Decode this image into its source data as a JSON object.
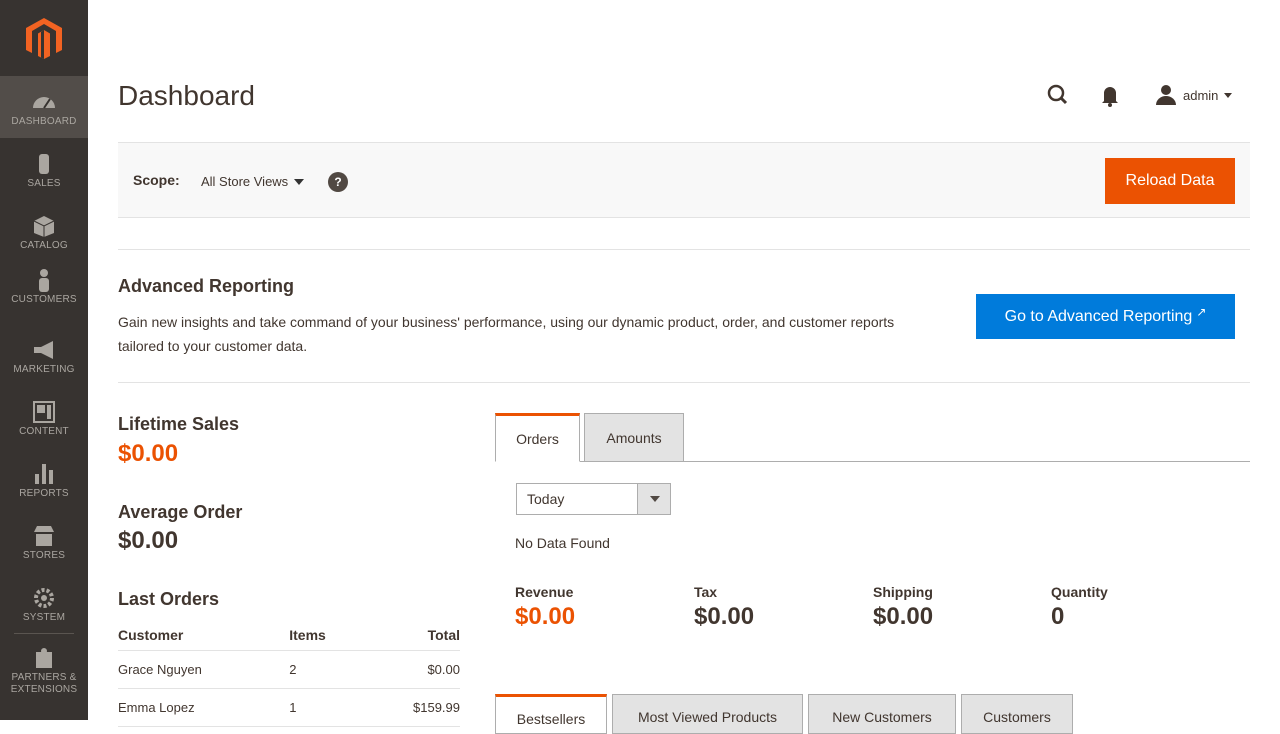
{
  "header": {
    "title": "Dashboard",
    "user": "admin"
  },
  "sidebar": {
    "items": [
      {
        "label": "Dashboard",
        "icon": "dashboard-icon"
      },
      {
        "label": "Sales",
        "icon": "dollar-icon"
      },
      {
        "label": "Catalog",
        "icon": "box-icon"
      },
      {
        "label": "Customers",
        "icon": "person-icon"
      },
      {
        "label": "Marketing",
        "icon": "megaphone-icon"
      },
      {
        "label": "Content",
        "icon": "layout-icon"
      },
      {
        "label": "Reports",
        "icon": "bar-chart-icon"
      },
      {
        "label": "Stores",
        "icon": "store-icon"
      },
      {
        "label": "System",
        "icon": "gear-icon"
      },
      {
        "label": "Partners & Extensions",
        "icon": "puzzle-icon"
      }
    ]
  },
  "scope": {
    "label": "Scope:",
    "value": "All Store Views",
    "help": "?",
    "reload_label": "Reload Data"
  },
  "advanced": {
    "title": "Advanced Reporting",
    "description": "Gain new insights and take command of your business' performance, using our dynamic product, order, and customer reports tailored to your customer data.",
    "button": "Go to Advanced Reporting"
  },
  "stats": {
    "lifetime_label": "Lifetime Sales",
    "lifetime_value": "$0.00",
    "average_label": "Average Order",
    "average_value": "$0.00",
    "last_orders_label": "Last Orders"
  },
  "last_orders": {
    "headers": [
      "Customer",
      "Items",
      "Total"
    ],
    "rows": [
      {
        "customer": "Grace Nguyen",
        "items": "2",
        "total": "$0.00"
      },
      {
        "customer": "Emma Lopez",
        "items": "1",
        "total": "$159.99"
      }
    ]
  },
  "chart_tabs": [
    "Orders",
    "Amounts"
  ],
  "period": "Today",
  "no_data": "No Data Found",
  "totals": [
    {
      "label": "Revenue",
      "value": "$0.00"
    },
    {
      "label": "Tax",
      "value": "$0.00"
    },
    {
      "label": "Shipping",
      "value": "$0.00"
    },
    {
      "label": "Quantity",
      "value": "0"
    }
  ],
  "bottom_tabs": [
    "Bestsellers",
    "Most Viewed Products",
    "New Customers",
    "Customers"
  ],
  "colors": {
    "accent": "#eb5202",
    "sidebar": "#373330",
    "link_button": "#007bdb"
  }
}
